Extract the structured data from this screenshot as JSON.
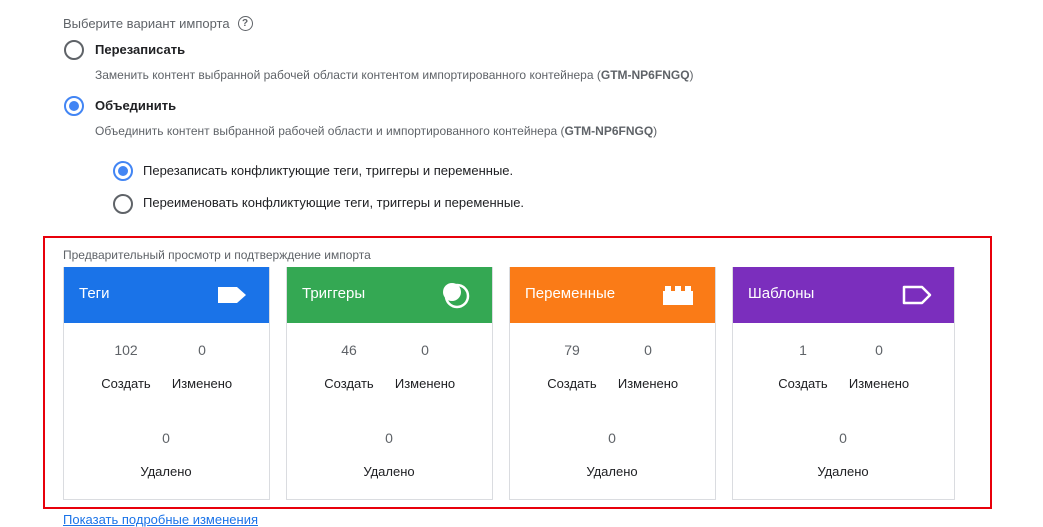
{
  "import_option": {
    "label": "Выберите вариант импорта",
    "help_icon": "help-icon",
    "overwrite": {
      "title": "Перезаписать",
      "desc_prefix": "Заменить контент выбранной рабочей области контентом импортированного контейнера (",
      "container_id": "GTM-NP6FNGQ",
      "desc_suffix": ")"
    },
    "merge": {
      "title": "Объединить",
      "desc_prefix": "Объединить контент выбранной рабочей области и импортированного контейнера (",
      "container_id": "GTM-NP6FNGQ",
      "desc_suffix": ")",
      "sub_options": [
        {
          "label": "Перезаписать конфликтующие теги, триггеры и переменные.",
          "checked": true
        },
        {
          "label": "Переименовать конфликтующие теги, триггеры и переменные.",
          "checked": false
        }
      ]
    }
  },
  "preview": {
    "label": "Предварительный просмотр и подтверждение импорта",
    "cards": [
      {
        "title": "Теги",
        "color": "#1a73e8",
        "icon": "tag-icon",
        "created": "102",
        "modified": "0",
        "deleted": "0"
      },
      {
        "title": "Триггеры",
        "color": "#34a853",
        "icon": "trigger-icon",
        "created": "46",
        "modified": "0",
        "deleted": "0"
      },
      {
        "title": "Переменные",
        "color": "#fa7b17",
        "icon": "variable-block-icon",
        "created": "79",
        "modified": "0",
        "deleted": "0"
      },
      {
        "title": "Шаблоны",
        "color": "#7b2ebd",
        "icon": "template-tag-icon",
        "created": "1",
        "modified": "0",
        "deleted": "0"
      }
    ],
    "labels": {
      "created": "Создать",
      "modified": "Изменено",
      "deleted": "Удалено"
    }
  },
  "details_link": "Показать подробные изменения"
}
